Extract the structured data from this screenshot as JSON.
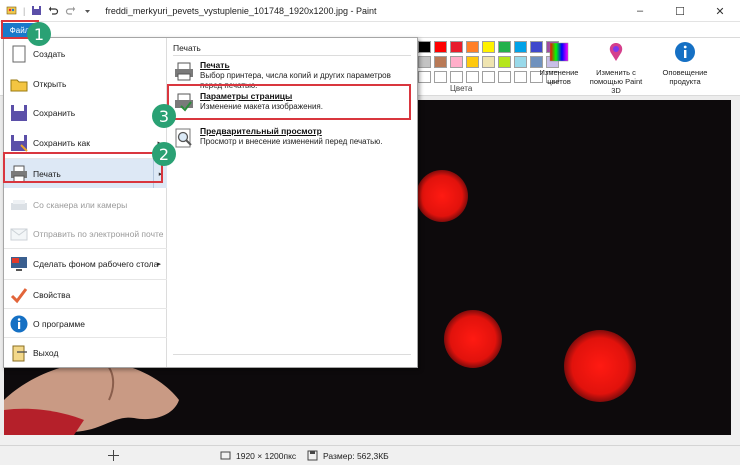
{
  "window": {
    "title": "freddi_merkyuri_pevets_vystuplenie_101748_1920x1200.jpg - Paint",
    "minimize": "–",
    "maximize": "☐",
    "close": "✕"
  },
  "file_tab": {
    "label": "Файл"
  },
  "ribbon": {
    "colors_label": "Цвета",
    "edit_colors": "Изменение цветов",
    "paint3d": "Изменить с помощью Paint 3D",
    "product_alert": "Оповещение продукта",
    "palette": [
      "#000000",
      "#ff0000",
      "#e81c2c",
      "#ff7f27",
      "#fff200",
      "#22b14c",
      "#00a2e8",
      "#3f48cc",
      "#a349a4",
      "#c3c3c3",
      "#b97a57",
      "#ffaec9",
      "#ffc90e",
      "#efe4b0",
      "#b5e61d",
      "#99d9ea",
      "#7092be",
      "#c8bfe7",
      "#ffffff",
      "#ffffff",
      "#ffffff",
      "#ffffff",
      "#ffffff",
      "#ffffff",
      "#ffffff",
      "#ffffff",
      "#ffffff"
    ]
  },
  "file_menu": {
    "items": [
      {
        "label": "Создать",
        "icon": "new-file-icon",
        "enabled": true
      },
      {
        "label": "Открыть",
        "icon": "open-folder-icon",
        "enabled": true
      },
      {
        "label": "Сохранить",
        "icon": "save-disk-icon",
        "enabled": true
      },
      {
        "label": "Сохранить как",
        "icon": "save-as-icon",
        "enabled": true,
        "submenu": true
      },
      {
        "label": "Печать",
        "icon": "printer-icon",
        "enabled": true,
        "submenu": true,
        "highlighted": true
      },
      {
        "label": "Со сканера или камеры",
        "icon": "scanner-icon",
        "enabled": false
      },
      {
        "label": "Отправить по электронной почте",
        "icon": "email-icon",
        "enabled": false
      },
      {
        "label": "Сделать фоном рабочего стола",
        "icon": "desktop-icon",
        "enabled": true,
        "submenu": true
      },
      {
        "label": "Свойства",
        "icon": "checkmark-icon",
        "enabled": true
      },
      {
        "label": "О программе",
        "icon": "info-icon",
        "enabled": true
      },
      {
        "label": "Выход",
        "icon": "exit-icon",
        "enabled": true
      }
    ],
    "print_submenu": {
      "title": "Печать",
      "items": [
        {
          "title": "Печать",
          "desc": "Выбор принтера, числа копий и других параметров перед печатью."
        },
        {
          "title": "Параметры страницы",
          "desc": "Изменение макета изображения."
        },
        {
          "title": "Предварительный просмотр",
          "desc": "Просмотр и внесение изменений перед печатью."
        }
      ]
    }
  },
  "status_bar": {
    "dimensions": "1920 × 1200пкс",
    "size": "Размер: 562,3КБ"
  },
  "annotations": {
    "step1": "1",
    "step2": "2",
    "step3": "3"
  }
}
